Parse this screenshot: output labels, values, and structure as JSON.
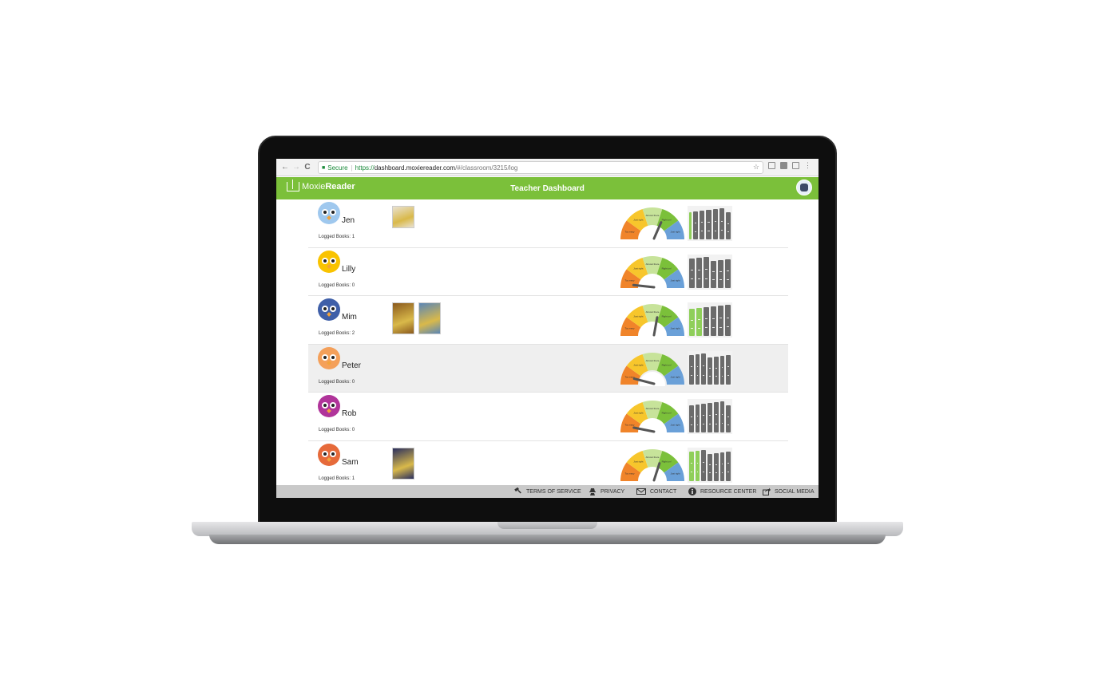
{
  "browser": {
    "back_icon": "←",
    "forward_icon": "→",
    "reload_icon": "C",
    "secure_label": "Secure",
    "url_scheme": "https://",
    "url_host": "dashboard.moxiereader.com",
    "url_path": "/#/classroom/3215/log"
  },
  "header": {
    "logo_light": "Moxie",
    "logo_bold": "Reader",
    "title": "Teacher Dashboard"
  },
  "students": [
    {
      "name": "Jen",
      "logged_label": "Logged Books: 1",
      "avatar_color": "#9fc8ee",
      "books": [
        "#e9e2d2"
      ]
    },
    {
      "name": "Lilly",
      "logged_label": "Logged Books: 0",
      "avatar_color": "#f9c300",
      "books": []
    },
    {
      "name": "Mim",
      "logged_label": "Logged Books: 2",
      "avatar_color": "#3f5fa8",
      "books": [
        "#8b5a1e",
        "#5a86b7"
      ]
    },
    {
      "name": "Peter",
      "logged_label": "Logged Books: 0",
      "avatar_color": "#f4a05a",
      "books": []
    },
    {
      "name": "Rob",
      "logged_label": "Logged Books: 0",
      "avatar_color": "#b0349a",
      "books": []
    },
    {
      "name": "Sam",
      "logged_label": "Logged Books: 1",
      "avatar_color": "#e66a3a",
      "books": [
        "#2a2f5e"
      ]
    }
  ],
  "gauge": {
    "zones": [
      {
        "label": "Too easy",
        "color": "#f0842a"
      },
      {
        "label": "Just right",
        "color": "#f7c62c"
      },
      {
        "label": "Almost there",
        "color": "#c7e39a"
      },
      {
        "label": "Right on!",
        "color": "#7bc03a"
      },
      {
        "label": "Just right",
        "color": "#6aa0d8"
      }
    ],
    "needle_levels": [
      0.65,
      0.05,
      0.58,
      0.1,
      0.08,
      0.62
    ]
  },
  "shelf_levels": [
    {
      "count": 7,
      "green": 1
    },
    {
      "count": 6,
      "green": 0
    },
    {
      "count": 6,
      "green": 2
    },
    {
      "count": 7,
      "green": 0
    },
    {
      "count": 7,
      "green": 0
    },
    {
      "count": 7,
      "green": 2
    }
  ],
  "footer": {
    "terms": "TERMS OF SERVICE",
    "privacy": "PRIVACY",
    "contact": "CONTACT",
    "resource": "RESOURCE CENTER",
    "social": "SOCIAL MEDIA"
  },
  "colors": {
    "brand_green": "#7bc03a",
    "spine_gray": "#6b6b6b",
    "spine_green": "#8fcf5a"
  }
}
